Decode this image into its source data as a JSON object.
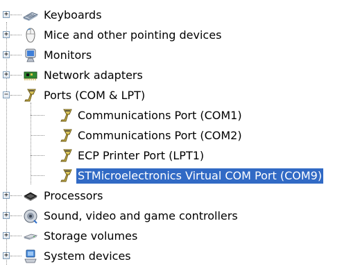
{
  "tree": {
    "categories": [
      {
        "label": "Keyboards",
        "icon": "keyboard-icon",
        "expander": "+"
      },
      {
        "label": "Mice and other pointing devices",
        "icon": "mouse-icon",
        "expander": "+"
      },
      {
        "label": "Monitors",
        "icon": "monitor-icon",
        "expander": "+"
      },
      {
        "label": "Network adapters",
        "icon": "network-adapter-icon",
        "expander": "+"
      },
      {
        "label": "Ports (COM & LPT)",
        "icon": "port-connector-icon",
        "expander": "−"
      },
      {
        "label": "Processors",
        "icon": "processor-icon",
        "expander": "+"
      },
      {
        "label": "Sound, video and game controllers",
        "icon": "speaker-icon",
        "expander": "+"
      },
      {
        "label": "Storage volumes",
        "icon": "storage-volume-icon",
        "expander": "+"
      },
      {
        "label": "System devices",
        "icon": "system-device-icon",
        "expander": "+"
      }
    ],
    "ports": [
      {
        "label": "Communications Port (COM1)",
        "icon": "port-connector-icon",
        "selected": false
      },
      {
        "label": "Communications Port (COM2)",
        "icon": "port-connector-icon",
        "selected": false
      },
      {
        "label": "ECP Printer Port (LPT1)",
        "icon": "port-connector-icon",
        "selected": false
      },
      {
        "label": "STMicroelectronics Virtual COM Port (COM9)",
        "icon": "port-connector-icon",
        "selected": true
      }
    ]
  },
  "colors": {
    "selection_bg": "#316ac5",
    "selection_text": "#ffffff",
    "tree_line": "#8c8c8c",
    "expander_border": "#7f9db9"
  }
}
